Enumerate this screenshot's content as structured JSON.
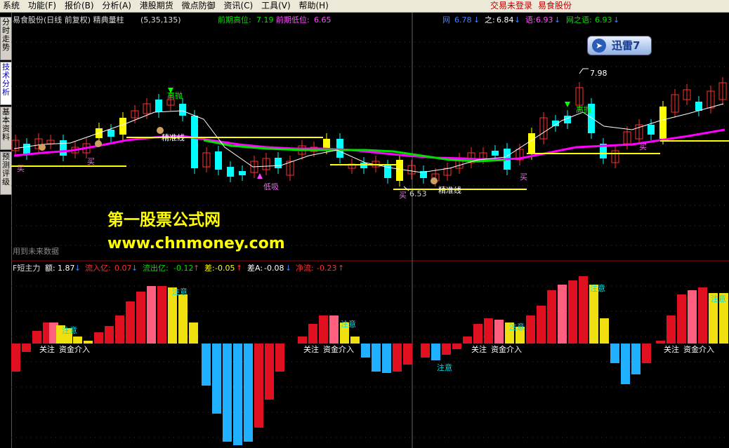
{
  "menu": {
    "items": [
      "系统",
      "功能(F)",
      "报价(B)",
      "分析(A)",
      "港股期货",
      "微点防御",
      "资讯(C)",
      "工具(V)",
      "帮助(H)"
    ],
    "login_status": "交易未登录",
    "stock_name_top": "易食股份"
  },
  "left_tabs": [
    "分时走势",
    "技术分析",
    "基本资料",
    "预测评级"
  ],
  "upper": {
    "title": "易食股份(日线 前复权) 精典量柱",
    "params": "(5,35,135)",
    "prev_high_label": "前期高位:",
    "prev_high_value": "7.19",
    "prev_low_label": "前期低位:",
    "prev_low_value": "6.65",
    "net_label": "网",
    "net_value": "6.78",
    "zhi_label": "之:",
    "zhi_value": "6.84",
    "yu_label": "语:",
    "yu_value": "6.93",
    "net_zhi_yu_label": "网之语:",
    "net_zhi_yu_value": "6.93",
    "future_data_note": "用到未来数据",
    "price_high": "7.98",
    "price_low": "6.53",
    "labels": {
      "sell_high": "高抛",
      "low_buy": "低吸",
      "buy": "买",
      "support_line": "精准线"
    }
  },
  "lower": {
    "title": "F短主力",
    "amount_label": "额:",
    "amount_value": "1.87",
    "inflow_label": "流入亿:",
    "inflow_value": "0.07",
    "outflow_label": "流出亿:",
    "outflow_value": "-0.12",
    "diff_label": "差:",
    "diff_value": "-0.05",
    "diffa_label": "差A:",
    "diffa_value": "-0.08",
    "net_label": "净流:",
    "net_value": "-0.23",
    "labels": {
      "attention": "关注",
      "capital_in": "资金介入",
      "notice": "注意"
    }
  },
  "watermark": {
    "line1": "第一股票公式网",
    "line2": "www.chnmoney.com"
  },
  "xunlei_badge": "迅雷7",
  "colors": {
    "up": "#ff3030",
    "down": "#00ffff",
    "yellow": "#ffff00",
    "magenta": "#ff00ff",
    "green": "#00e000",
    "blue": "#00a0ff"
  }
}
